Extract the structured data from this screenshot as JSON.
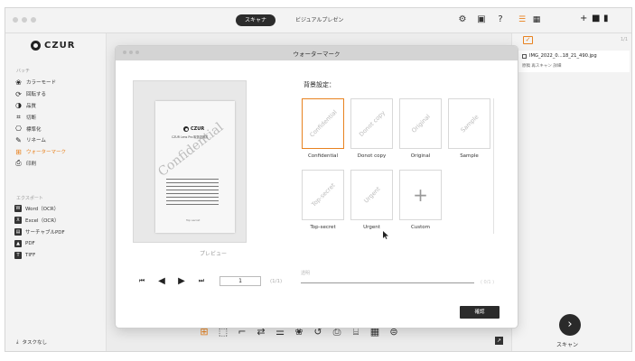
{
  "titlebar": {
    "tabs": [
      {
        "label": "スキャナ",
        "active": true
      },
      {
        "label": "ビジュアルプレゼン",
        "active": false
      }
    ],
    "icons": [
      "settings-icon",
      "chat-icon",
      "help-icon"
    ]
  },
  "sidebar": {
    "logo": "CZUR",
    "batch_label": "バッチ",
    "items": [
      {
        "label": "カラーモード",
        "icon": "palette-icon"
      },
      {
        "label": "回転する",
        "icon": "rotate-icon"
      },
      {
        "label": "品質",
        "icon": "quality-icon"
      },
      {
        "label": "切断",
        "icon": "crop-icon"
      },
      {
        "label": "標準化",
        "icon": "standardize-icon"
      },
      {
        "label": "リネーム",
        "icon": "rename-icon"
      },
      {
        "label": "ウォーターマーク",
        "icon": "watermark-icon",
        "active": true
      },
      {
        "label": "印刷",
        "icon": "print-icon"
      }
    ],
    "export_label": "エクスポート",
    "export_items": [
      {
        "label": "Word（OCR）",
        "icon": "word-icon",
        "glyph": "W"
      },
      {
        "label": "Excel（OCR）",
        "icon": "excel-icon",
        "glyph": "X"
      },
      {
        "label": "サーチャブルPDF",
        "icon": "searchable-pdf-icon",
        "glyph": "▤"
      },
      {
        "label": "PDF",
        "icon": "pdf-icon",
        "glyph": "▲"
      },
      {
        "label": "TIFF",
        "icon": "tiff-icon",
        "glyph": "T"
      }
    ],
    "no_task": "タスクなし"
  },
  "right_panel": {
    "file_name": "IMG_2022_0...18_21_490.jpg",
    "file_meta": "原稿  再スキャン  詳細",
    "scan_label": "スキャン",
    "accent": "#e8821f"
  },
  "dialog": {
    "title": "ウォーターマーク",
    "preview_label": "プレビュー",
    "background_label": "背景設定：",
    "preview_doc": {
      "logo": "CZUR",
      "subtitle": "CZUR Lens Pro 取扱説明書",
      "watermark": "Confidential",
      "footer": "Top secret"
    },
    "watermarks": [
      {
        "label": "Confidential",
        "tile": "Confidential",
        "selected": true
      },
      {
        "label": "Donot copy",
        "tile": "Donot copy",
        "selected": false
      },
      {
        "label": "Original",
        "tile": "Original",
        "selected": false
      },
      {
        "label": "Sample",
        "tile": "Sample",
        "selected": false
      },
      {
        "label": "Top-secret",
        "tile": "Top-secret",
        "selected": false
      },
      {
        "label": "Urgent",
        "tile": "Urgent",
        "selected": false
      },
      {
        "label": "Custom",
        "tile": "+",
        "selected": false
      }
    ],
    "page_current": "1",
    "page_total": "(1/1)",
    "opacity_label": "透明",
    "opacity_value": "( 0/1 )",
    "confirm_label": "確認"
  }
}
